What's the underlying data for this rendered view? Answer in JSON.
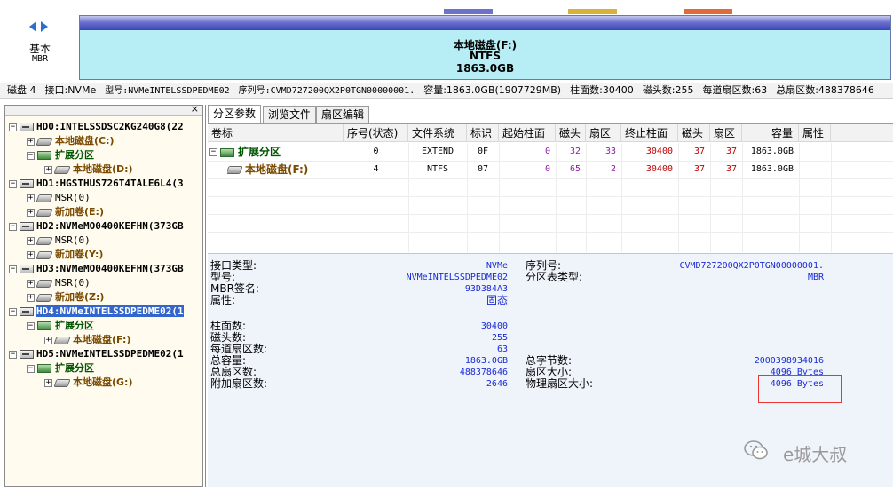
{
  "topbar": {
    "basic": "基本",
    "mbr": "MBR",
    "partition_name": "本地磁盘(F:)",
    "partition_fs": "NTFS",
    "partition_size": "1863.0GB"
  },
  "disk_info": {
    "disk": "磁盘 4",
    "interface": "接口:NVMe",
    "model": "型号:NVMeINTELSSDPEDME02",
    "serial": "序列号:CVMD727200QX2P0TGN00000001.",
    "capacity": "容量:1863.0GB(1907729MB)",
    "cylinders": "柱面数:30400",
    "heads": "磁头数:255",
    "sectors_per_track": "每道扇区数:63",
    "total_sectors": "总扇区数:488378646"
  },
  "tree": {
    "close": "×",
    "items": [
      {
        "label": "HD0:INTELSSDSC2KG240G8(22",
        "kind": "disk"
      },
      {
        "label": "本地磁盘(C:)",
        "kind": "vol"
      },
      {
        "label": "扩展分区",
        "kind": "ext"
      },
      {
        "label": "本地磁盘(D:)",
        "kind": "vol"
      },
      {
        "label": "HD1:HGSTHUS726T4TALE6L4(3",
        "kind": "disk"
      },
      {
        "label": "MSR(0)",
        "kind": "msr"
      },
      {
        "label": "新加卷(E:)",
        "kind": "vol"
      },
      {
        "label": "HD2:NVMeMO0400KEFHN(373GB",
        "kind": "disk"
      },
      {
        "label": "MSR(0)",
        "kind": "msr"
      },
      {
        "label": "新加卷(Y:)",
        "kind": "vol"
      },
      {
        "label": "HD3:NVMeMO0400KEFHN(373GB",
        "kind": "disk"
      },
      {
        "label": "MSR(0)",
        "kind": "msr"
      },
      {
        "label": "新加卷(Z:)",
        "kind": "vol"
      },
      {
        "label": "HD4:NVMeINTELSSDPEDME02(1",
        "kind": "disk"
      },
      {
        "label": "扩展分区",
        "kind": "ext"
      },
      {
        "label": "本地磁盘(F:)",
        "kind": "vol"
      },
      {
        "label": "HD5:NVMeINTELSSDPEDME02(1",
        "kind": "disk"
      },
      {
        "label": "扩展分区",
        "kind": "ext"
      },
      {
        "label": "本地磁盘(G:)",
        "kind": "vol"
      }
    ]
  },
  "tabs": [
    "分区参数",
    "浏览文件",
    "扇区编辑"
  ],
  "table": {
    "headers": [
      "卷标",
      "序号(状态)",
      "文件系统",
      "标识",
      "起始柱面",
      "磁头",
      "扇区",
      "终止柱面",
      "磁头",
      "扇区",
      "容量",
      "属性"
    ],
    "rows": [
      {
        "label": "扩展分区",
        "index": "0",
        "fs": "EXTEND",
        "id": "0F",
        "start_cyl": "0",
        "start_head": "32",
        "start_sec": "33",
        "end_cyl": "30400",
        "end_head": "37",
        "end_sec": "37",
        "capacity": "1863.0GB",
        "attr": ""
      },
      {
        "label": "本地磁盘(F:)",
        "index": "4",
        "fs": "NTFS",
        "id": "07",
        "start_cyl": "0",
        "start_head": "65",
        "start_sec": "2",
        "end_cyl": "30400",
        "end_head": "37",
        "end_sec": "37",
        "capacity": "1863.0GB",
        "attr": ""
      }
    ]
  },
  "details": {
    "interface_type_label": "接口类型:",
    "interface_type_value": "NVMe",
    "model_label": "型号:",
    "model_value": "NVMeINTELSSDPEDME02",
    "mbr_sig_label": "MBR签名:",
    "mbr_sig_value": "93D384A3",
    "attr_label": "属性:",
    "attr_value": "固态",
    "serial_label": "序列号:",
    "serial_value": "CVMD727200QX2P0TGN00000001.",
    "pt_type_label": "分区表类型:",
    "pt_type_value": "MBR",
    "cylinders_label": "柱面数:",
    "cylinders_value": "30400",
    "heads_label": "磁头数:",
    "heads_value": "255",
    "spt_label": "每道扇区数:",
    "spt_value": "63",
    "capacity_label": "总容量:",
    "capacity_value": "1863.0GB",
    "total_sectors_label": "总扇区数:",
    "total_sectors_value": "488378646",
    "extra_sectors_label": "附加扇区数:",
    "extra_sectors_value": "2646",
    "total_bytes_label": "总字节数:",
    "total_bytes_value": "2000398934016",
    "sector_size_label": "扇区大小:",
    "sector_size_value": "4096 Bytes",
    "phys_sector_size_label": "物理扇区大小:",
    "phys_sector_size_value": "4096 Bytes"
  },
  "watermark": {
    "text": "e城大叔"
  }
}
